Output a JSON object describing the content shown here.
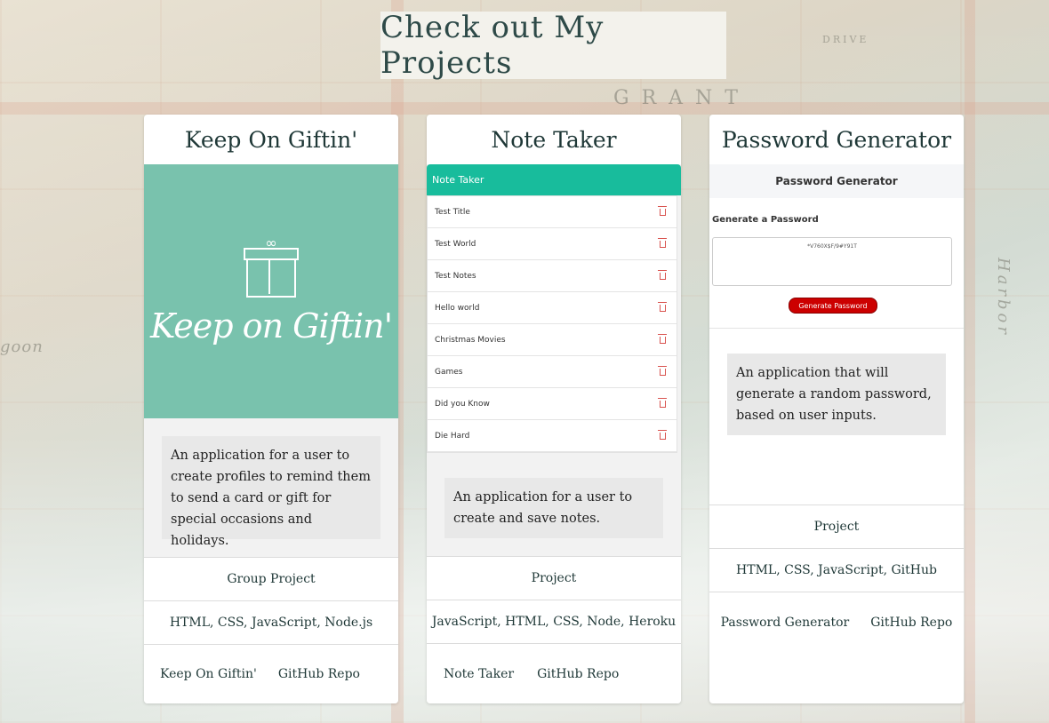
{
  "page": {
    "title": "Check out My Projects"
  },
  "map_labels": [
    "GRANT",
    "DRIVE",
    "goon",
    "Harbor"
  ],
  "cards": [
    {
      "title": "Keep On Giftin'",
      "image_text": "Keep on Giftin'",
      "description": "An application for a user to create profiles to remind them to send a card or gift for special occasions and holidays.",
      "type": "Group Project",
      "tech": "HTML, CSS, JavaScript, Node.js",
      "link_app": "Keep On Giftin'",
      "link_repo": "GitHub Repo"
    },
    {
      "title": "Note Taker",
      "header": "Note Taker",
      "notes": [
        "Test Title",
        "Test World",
        "Test Notes",
        "Hello world",
        "Christmas Movies",
        "Games",
        "Did you Know",
        "Die Hard"
      ],
      "description": "An application for a user to create and save notes.",
      "type": "Project",
      "tech": "JavaScript, HTML, CSS, Node, Heroku",
      "link_app": "Note Taker",
      "link_repo": "GitHub Repo"
    },
    {
      "title": "Password Generator",
      "header": "Password Generator",
      "label": "Generate a Password",
      "password": "*V760X$F/9#Y91T",
      "button": "Generate Password",
      "description": "An application that will generate a random password, based on user inputs.",
      "type": "Project",
      "tech": "HTML, CSS, JavaScript, GitHub",
      "link_app": "Password Generator",
      "link_repo": "GitHub Repo"
    }
  ],
  "colors": {
    "title_text": "#2e4a48",
    "giftin_bg": "#79c2ad",
    "note_header": "#18bc9c",
    "delete_icon": "#d9534f",
    "pg_button": "#cc0000"
  }
}
